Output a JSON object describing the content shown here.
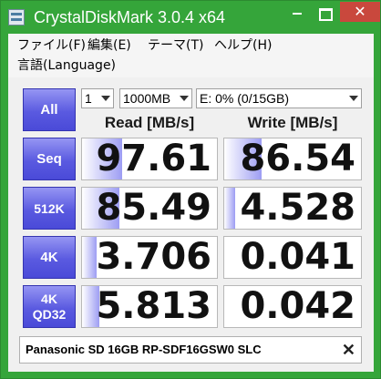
{
  "window": {
    "title": "CrystalDiskMark 3.0.4 x64",
    "close_label": "✕"
  },
  "menu": {
    "file": "ファイル(F)",
    "edit": "編集(E)",
    "theme": "テーマ(T)",
    "help": "ヘルプ(H)",
    "language": "言語(Language)"
  },
  "controls": {
    "all_label": "All",
    "count": "1",
    "size": "1000MB",
    "drive": "E: 0% (0/15GB)"
  },
  "headers": {
    "read": "Read [MB/s]",
    "write": "Write [MB/s]"
  },
  "tests": [
    {
      "label": "Seq",
      "read": "97.61",
      "write": "86.54",
      "read_fill": 0.3,
      "write_fill": 0.27
    },
    {
      "label": "512K",
      "read": "85.49",
      "write": "4.528",
      "read_fill": 0.28,
      "write_fill": 0.08
    },
    {
      "label": "4K",
      "read": "3.706",
      "write": "0.041",
      "read_fill": 0.11,
      "write_fill": 0.0
    },
    {
      "label_line1": "4K",
      "label_line2": "QD32",
      "read": "5.813",
      "write": "0.042",
      "read_fill": 0.13,
      "write_fill": 0.0
    }
  ],
  "comment": {
    "text": "Panasonic SD 16GB RP-SDF16GSW0 SLC",
    "clear_label": "✕"
  },
  "colors": {
    "titlebar": "#35a53a",
    "button": "#5a5ae0",
    "bar_fill": "#9d9df3"
  }
}
